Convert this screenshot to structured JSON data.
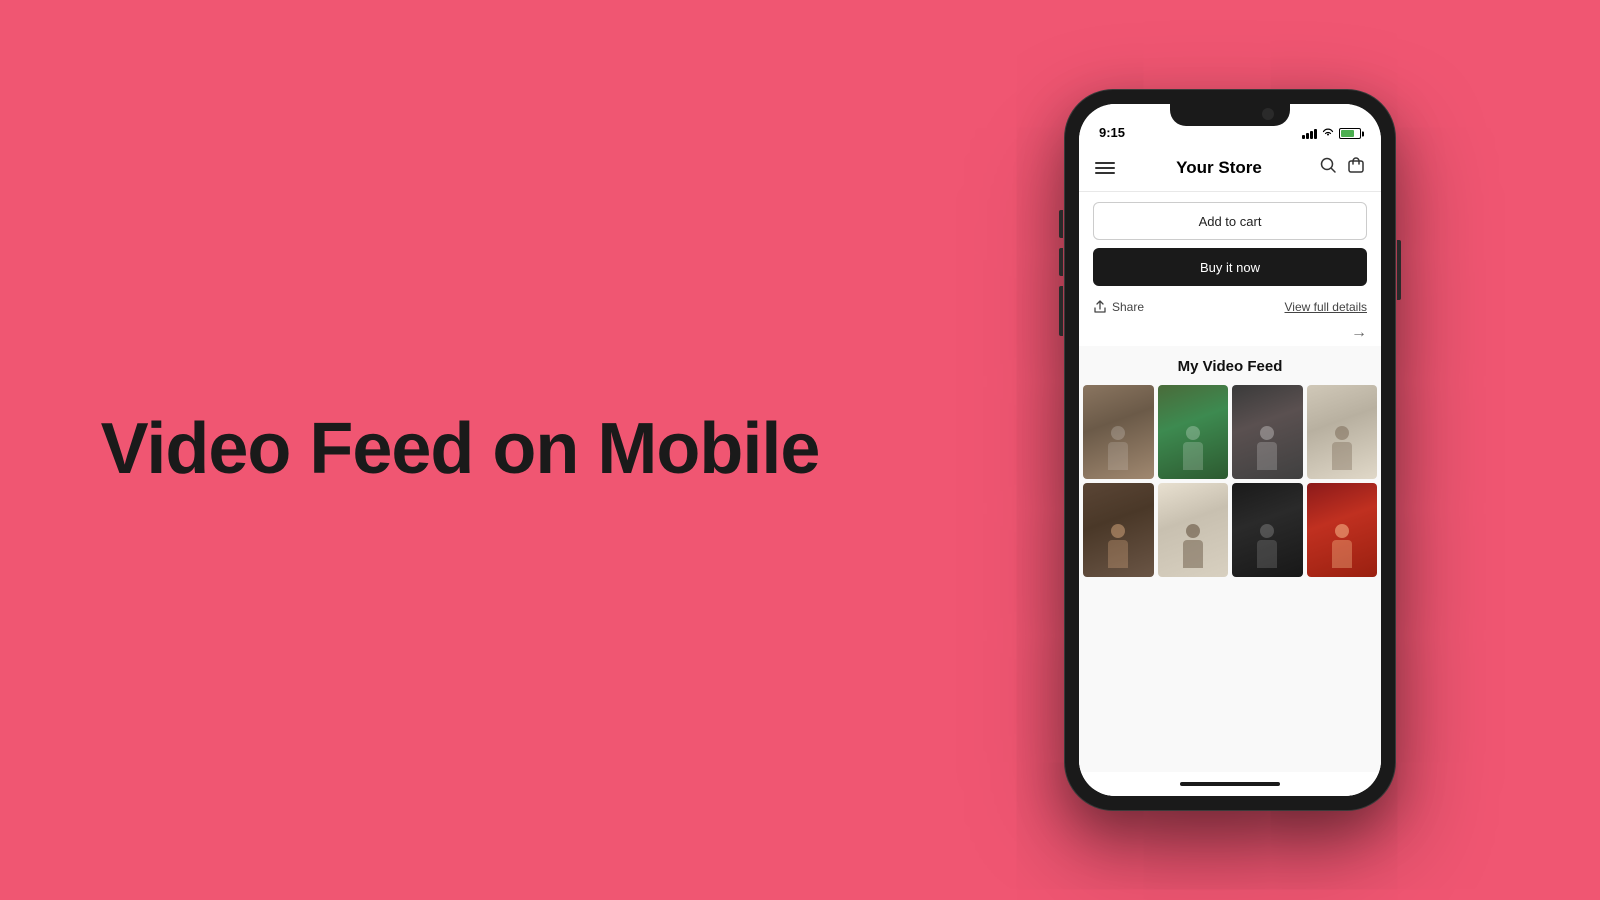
{
  "background_color": "#f05672",
  "hero": {
    "title": "Video Feed on Mobile"
  },
  "phone": {
    "status_bar": {
      "time": "9:15",
      "location_arrow": "▷"
    },
    "nav": {
      "store_name": "Your Store"
    },
    "buttons": {
      "add_to_cart": "Add to cart",
      "buy_now": "Buy it now"
    },
    "actions": {
      "share": "Share",
      "view_full_details": "View full details"
    },
    "video_feed": {
      "title": "My Video Feed",
      "thumbnails": [
        {
          "id": 1,
          "class": "thumb-1"
        },
        {
          "id": 2,
          "class": "thumb-2"
        },
        {
          "id": 3,
          "class": "thumb-3"
        },
        {
          "id": 4,
          "class": "thumb-4"
        },
        {
          "id": 5,
          "class": "thumb-5"
        },
        {
          "id": 6,
          "class": "thumb-6"
        },
        {
          "id": 7,
          "class": "thumb-7"
        },
        {
          "id": 8,
          "class": "thumb-8"
        }
      ]
    }
  }
}
